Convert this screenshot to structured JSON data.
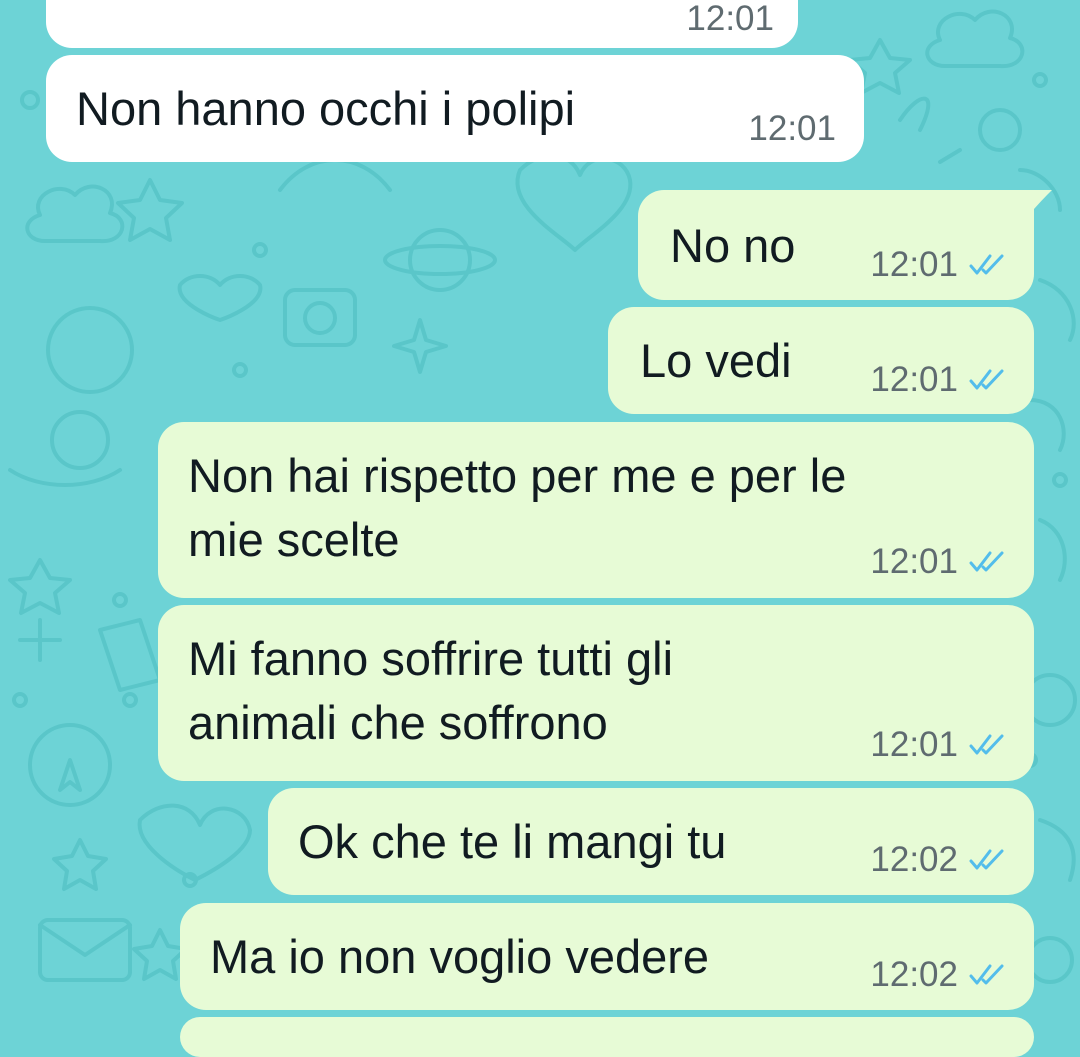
{
  "theme": {
    "background": "#6dd3d6",
    "incoming_bubble": "#ffffff",
    "outgoing_bubble": "#e7fbd6",
    "tick_color": "#53bdeb",
    "timestamp_color": "#5f6b70"
  },
  "messages": [
    {
      "id": "partial-top",
      "direction": "incoming",
      "text": "",
      "time": "12:01",
      "status": ""
    },
    {
      "id": "polipi",
      "direction": "incoming",
      "text": "Non hanno occhi i polipi",
      "time": "12:01",
      "status": ""
    },
    {
      "id": "no-no",
      "direction": "outgoing",
      "text": "No no",
      "time": "12:01",
      "status": "read"
    },
    {
      "id": "lo-vedi",
      "direction": "outgoing",
      "text": "Lo vedi",
      "time": "12:01",
      "status": "read"
    },
    {
      "id": "rispetto",
      "direction": "outgoing",
      "text": "Non hai rispetto per me e per le\nmie scelte",
      "time": "12:01",
      "status": "read"
    },
    {
      "id": "soffrire",
      "direction": "outgoing",
      "text": "Mi fanno soffrire tutti gli\nanimali che soffrono",
      "time": "12:01",
      "status": "read"
    },
    {
      "id": "mangi",
      "direction": "outgoing",
      "text": "Ok che te li mangi tu",
      "time": "12:02",
      "status": "read"
    },
    {
      "id": "vedere",
      "direction": "outgoing",
      "text": "Ma io non voglio vedere",
      "time": "12:02",
      "status": "read"
    }
  ]
}
